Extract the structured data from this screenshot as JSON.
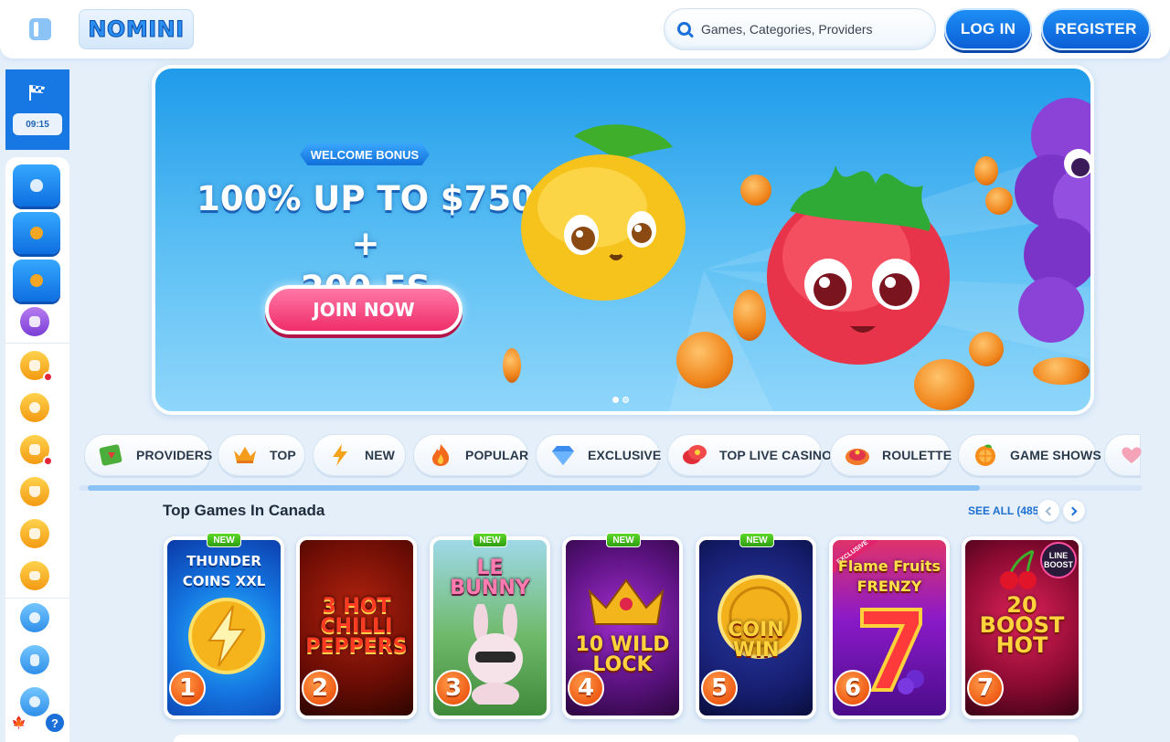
{
  "header": {
    "logo_text": "NOMINI",
    "search_placeholder": "Games, Categories, Providers",
    "login_label": "LOG IN",
    "register_label": "REGISTER"
  },
  "sidebar": {
    "timer": "09:15",
    "items": [
      {
        "icon": "egg-icon",
        "style": "blue-button"
      },
      {
        "icon": "rocket-icon",
        "style": "blue-button"
      },
      {
        "icon": "sports-ball-icon",
        "style": "blue-button"
      },
      {
        "icon": "gift-icon",
        "style": "purple-circle"
      },
      {
        "icon": "dice-icon",
        "style": "orange-circle",
        "alert": true
      },
      {
        "icon": "medal-icon",
        "style": "orange-circle"
      },
      {
        "icon": "cards-icon",
        "style": "orange-circle",
        "alert": true
      },
      {
        "icon": "trophy-icon",
        "style": "orange-circle"
      },
      {
        "icon": "shop-icon",
        "style": "orange-circle"
      },
      {
        "icon": "crown-icon",
        "style": "orange-circle"
      },
      {
        "icon": "cherry-icon",
        "style": "blue-circle"
      },
      {
        "icon": "card-icon",
        "style": "blue-circle"
      },
      {
        "icon": "clover-icon",
        "style": "blue-circle"
      }
    ],
    "language_flag": "🍁",
    "help_label": "?"
  },
  "banner": {
    "tag": "WELCOME BONUS",
    "title_line1": "100% UP TO $750 +",
    "title_line2": "200 FS",
    "cta_label": "JOIN NOW",
    "slide_count": 2,
    "active_slide": 1
  },
  "categories": [
    {
      "label": "PROVIDERS",
      "icon": "book-icon"
    },
    {
      "label": "TOP",
      "icon": "crown-icon"
    },
    {
      "label": "NEW",
      "icon": "lightning-icon"
    },
    {
      "label": "POPULAR",
      "icon": "fire-icon"
    },
    {
      "label": "EXCLUSIVE",
      "icon": "diamond-icon"
    },
    {
      "label": "TOP LIVE CASINO",
      "icon": "chips-icon"
    },
    {
      "label": "ROULETTE",
      "icon": "roulette-icon"
    },
    {
      "label": "GAME SHOWS",
      "icon": "orange-slice-icon"
    },
    {
      "label": "",
      "icon": "heart-icon"
    }
  ],
  "top_games": {
    "title": "Top Games In Canada",
    "see_all": "SEE ALL (485)",
    "new_label": "NEW",
    "games": [
      {
        "rank": "1",
        "title": "THUNDER COINS XXL",
        "is_new": true
      },
      {
        "rank": "2",
        "title": "3 HOT CHILLI PEPPERS",
        "is_new": false
      },
      {
        "rank": "3",
        "title": "LE BUNNY",
        "is_new": true
      },
      {
        "rank": "4",
        "title": "10 WILD LOCK",
        "is_new": true
      },
      {
        "rank": "5",
        "title": "COIN WIN",
        "is_new": true
      },
      {
        "rank": "6",
        "title": "Flame Fruits FRENZY",
        "is_new": false,
        "ribbon": "EXCLUSIVE"
      },
      {
        "rank": "7",
        "title": "20 BOOST HOT",
        "is_new": false,
        "badge": "LINE BOOST"
      }
    ]
  }
}
